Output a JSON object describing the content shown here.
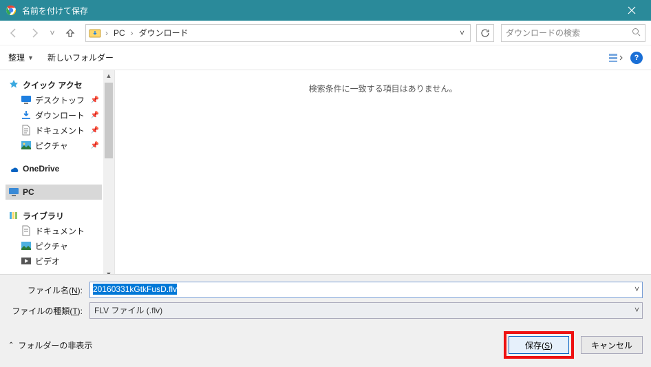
{
  "title": "名前を付けて保存",
  "breadcrumb": {
    "part1": "PC",
    "part2": "ダウンロード"
  },
  "search_placeholder": "ダウンロードの検索",
  "toolbar": {
    "organize": "整理",
    "newfolder": "新しいフォルダー"
  },
  "empty_msg": "検索条件に一致する項目はありません。",
  "tree": {
    "quick": "クイック アクセ",
    "desktop": "デスクトッフ",
    "downloads": "ダウンロート",
    "documents": "ドキュメント",
    "pictures": "ピクチャ",
    "onedrive": "OneDrive",
    "pc": "PC",
    "libraries": "ライブラリ",
    "lib_documents": "ドキュメント",
    "lib_pictures": "ピクチャ",
    "lib_videos": "ビデオ"
  },
  "filename_label": "ファイル名(N):",
  "filename_value": "20160331kGtkFusD.flv",
  "filetype_label": "ファイルの種類(T):",
  "filetype_value": "FLV ファイル (.flv)",
  "hide_folders": "フォルダーの非表示",
  "save_btn": "保存(S)",
  "cancel_btn": "キャンセル"
}
